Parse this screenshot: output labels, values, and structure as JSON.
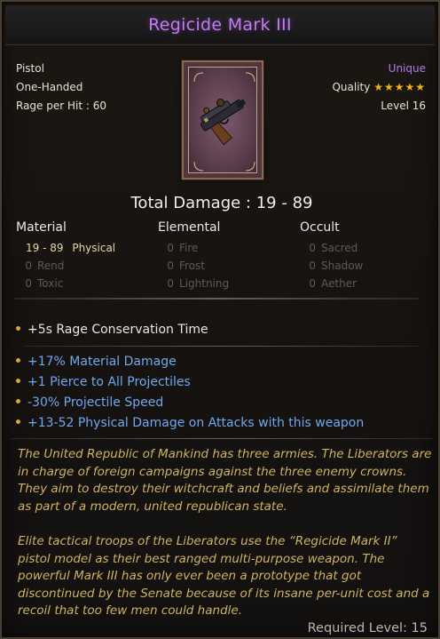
{
  "item": {
    "name": "Regicide Mark III",
    "type": "Pistol",
    "handedness": "One-Handed",
    "rage_per_hit": "Rage per Hit : 60",
    "rarity": "Unique",
    "quality_label": "Quality",
    "quality_stars": 5,
    "quality_stars_text": "★★★★★",
    "level": "Level 16",
    "rarity_color": "#b07ae8",
    "title_color": "#c17cf0"
  },
  "damage": {
    "total": "Total Damage : 19 - 89",
    "columns": [
      {
        "header": "Material",
        "rows": [
          {
            "value": "19 - 89",
            "label": "Physical"
          },
          {
            "value": "0",
            "label": "Rend"
          },
          {
            "value": "0",
            "label": "Toxic"
          }
        ]
      },
      {
        "header": "Elemental",
        "rows": [
          {
            "value": "0",
            "label": "Fire"
          },
          {
            "value": "0",
            "label": "Frost"
          },
          {
            "value": "0",
            "label": "Lightning"
          }
        ]
      },
      {
        "header": "Occult",
        "rows": [
          {
            "value": "0",
            "label": "Sacred"
          },
          {
            "value": "0",
            "label": "Shadow"
          },
          {
            "value": "0",
            "label": "Aether"
          }
        ]
      }
    ]
  },
  "implicit": "+5s Rage Conservation Time",
  "modifiers": [
    "+17% Material Damage",
    "+1 Pierce to All Projectiles",
    "-30% Projectile Speed",
    "+13-52 Physical Damage on Attacks with this weapon"
  ],
  "lore": {
    "lines_1": [
      "The United Republic of Mankind has three armies. The Liberators are",
      "in charge of foreign campaigns against the three enemy crowns.",
      "They aim to destroy their witchcraft and beliefs and assimilate them",
      "as part of a modern, united republican state."
    ],
    "lines_2": [
      "Elite tactical troops of the Liberators use the “Regicide Mark II”",
      "pistol model as their best ranged multi-purpose weapon. The",
      "powerful Mark III has only ever been a prototype that got",
      "discontinued by the Senate because of its insane per-unit cost and a",
      "recoil that too few men could handle."
    ]
  },
  "required_level": "Required Level: 15",
  "icons": {
    "item_art": "pistol-icon",
    "bullet": "bullet-dot-icon",
    "star": "star-icon"
  },
  "colors": {
    "modifier_blue": "#6fa8f0",
    "lore_gold": "#cfb360",
    "bullet_gold": "#d9a63a",
    "star_gold": "#f4b21b"
  }
}
